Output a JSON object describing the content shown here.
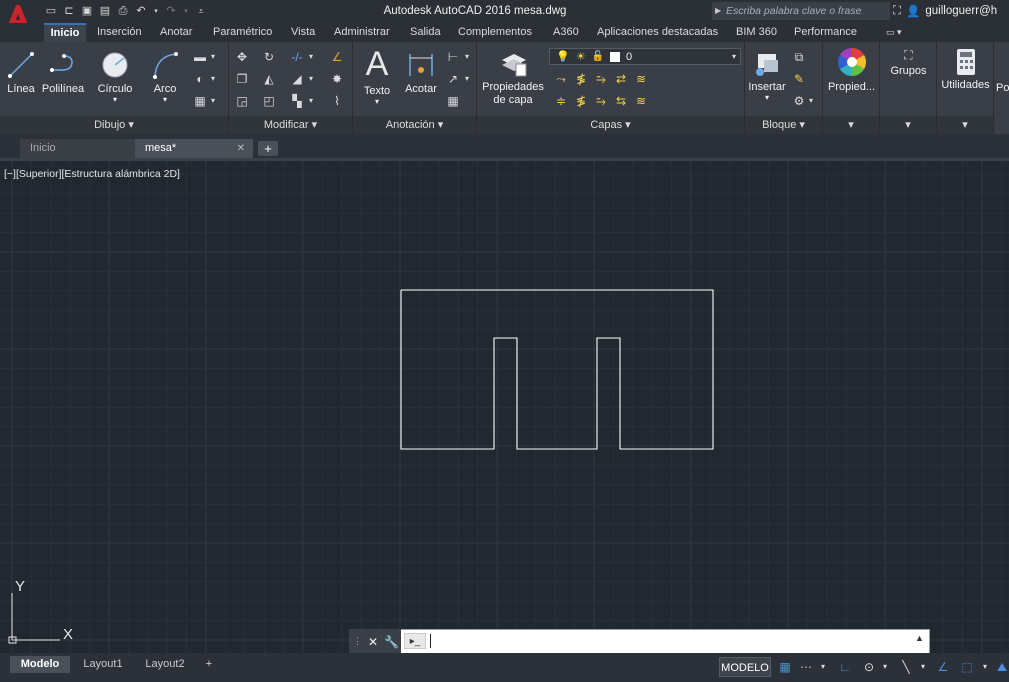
{
  "title_bar": {
    "app_title": "Autodesk AutoCAD 2016   mesa.dwg",
    "search_placeholder": "Escriba palabra clave o frase",
    "user": "guilloguerr@h",
    "qat_icons": [
      "new-icon",
      "open-icon",
      "save-icon",
      "save-as-icon",
      "print-icon",
      "undo-icon",
      "redo-icon",
      "customize-icon"
    ]
  },
  "ribbon_tabs": [
    "Inicio",
    "Inserción",
    "Anotar",
    "Paramétrico",
    "Vista",
    "Administrar",
    "Salida",
    "Complementos",
    "A360",
    "Aplicaciones destacadas",
    "BIM 360",
    "Performance"
  ],
  "ribbon": {
    "dibujo": {
      "title": "Dibujo ▾",
      "buttons": [
        "Línea",
        "Polilínea",
        "Círculo",
        "Arco"
      ]
    },
    "modificar": {
      "title": "Modificar ▾"
    },
    "anotacion": {
      "title": "Anotación ▾",
      "buttons": [
        "Texto",
        "Acotar"
      ]
    },
    "capas": {
      "title": "Capas ▾",
      "button": "Propiedades de capa",
      "button_line1": "Propiedades",
      "button_line2": "de capa",
      "layer_value": "0"
    },
    "bloque": {
      "title": "Bloque ▾",
      "button": "Insertar"
    },
    "propiedades": {
      "button": "Propied..."
    },
    "grupos": {
      "button": "Grupos"
    },
    "utilidades": {
      "button": "Utilidades"
    },
    "cut_off": "Po"
  },
  "doc_tabs": {
    "inicio": "Inicio",
    "mesa": "mesa*"
  },
  "viewport_label": "[−][Superior][Estructura alámbrica 2D]",
  "ucs": {
    "x_label": "X",
    "y_label": "Y"
  },
  "layout_tabs": [
    "Modelo",
    "Layout1",
    "Layout2"
  ],
  "status": {
    "model_button": "MODELO"
  },
  "colors": {
    "canvas": "#212830",
    "grid_minor": "#283039",
    "grid_major": "#2f3844",
    "drawing_line": "#ffffff",
    "accent": "#3b6fb7",
    "logo_red": "#c8262a"
  }
}
